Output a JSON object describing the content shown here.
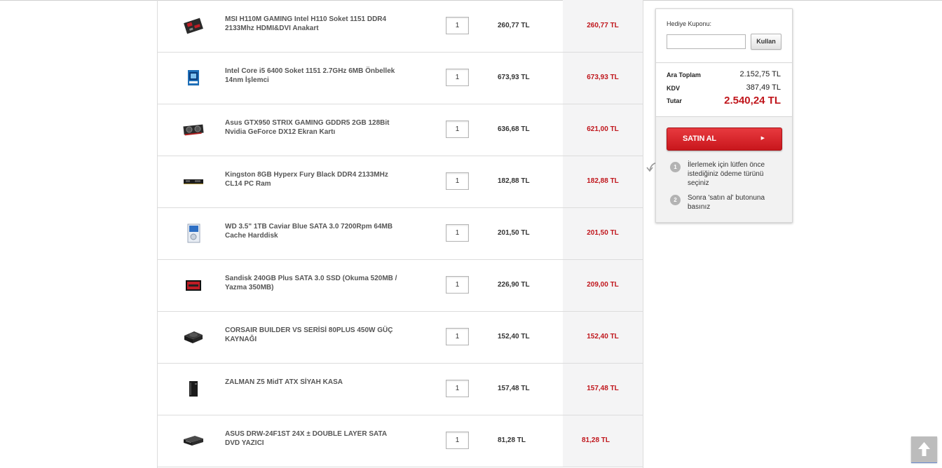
{
  "cart": {
    "items": [
      {
        "name": "MSI H110M GAMING Intel H110 Soket 1151 DDR4 2133Mhz HDMI&DVI Anakart",
        "icon": "motherboard-icon",
        "qty": "1",
        "unit_price": "260,77 TL",
        "total_price": "260,77 TL"
      },
      {
        "name": "Intel Core i5 6400 Soket 1151 2.7GHz 6MB Önbellek 14nm İşlemci",
        "icon": "cpu-box-icon",
        "qty": "1",
        "unit_price": "673,93 TL",
        "total_price": "673,93 TL"
      },
      {
        "name": "Asus GTX950 STRIX GAMING GDDR5 2GB 128Bit Nvidia GeForce DX12 Ekran Kartı",
        "icon": "graphics-card-icon",
        "qty": "1",
        "unit_price": "636,68 TL",
        "total_price": "621,00 TL"
      },
      {
        "name": "Kingston 8GB Hyperx Fury Black DDR4 2133MHz CL14 PC Ram",
        "icon": "ram-icon",
        "qty": "1",
        "unit_price": "182,88 TL",
        "total_price": "182,88 TL"
      },
      {
        "name": "WD 3.5\" 1TB Caviar Blue SATA 3.0 7200Rpm 64MB Cache Harddisk",
        "icon": "hard-disk-icon",
        "qty": "1",
        "unit_price": "201,50 TL",
        "total_price": "201,50 TL"
      },
      {
        "name": "Sandisk 240GB Plus SATA 3.0 SSD (Okuma 520MB / Yazma 350MB)",
        "icon": "ssd-icon",
        "qty": "1",
        "unit_price": "226,90 TL",
        "total_price": "209,00 TL"
      },
      {
        "name": "CORSAIR BUILDER VS SERİSİ 80PLUS 450W GÜÇ KAYNAĞI",
        "icon": "power-supply-icon",
        "qty": "1",
        "unit_price": "152,40 TL",
        "total_price": "152,40 TL"
      },
      {
        "name": "ZALMAN Z5 MidT ATX SİYAH KASA",
        "icon": "pc-case-icon",
        "qty": "1",
        "unit_price": "157,48 TL",
        "total_price": "157,48 TL"
      },
      {
        "name": "ASUS DRW-24F1ST 24X ± DOUBLE LAYER SATA DVD YAZICI",
        "icon": "dvd-writer-icon",
        "qty": "1",
        "unit_price": "81,28 TL",
        "total_price": "81,28 TL"
      }
    ]
  },
  "summary": {
    "coupon_label": "Hediye Kuponu:",
    "coupon_value": "",
    "coupon_button": "Kullan",
    "subtotal_label": "Ara Toplam",
    "subtotal_value": "2.152,75 TL",
    "tax_label": "KDV",
    "tax_value": "387,49 TL",
    "total_label": "Tutar",
    "total_value": "2.540,24 TL",
    "buy_label": "SATIN AL",
    "steps": [
      {
        "num": "1",
        "text": "İlerlemek için lütfen önce istediğiniz ödeme türünü seçiniz"
      },
      {
        "num": "2",
        "text": "Sonra 'satın al' butonuna basınız"
      }
    ],
    "accent_color": "#c0161c"
  },
  "scroll_top_icon": "arrow-up-icon"
}
